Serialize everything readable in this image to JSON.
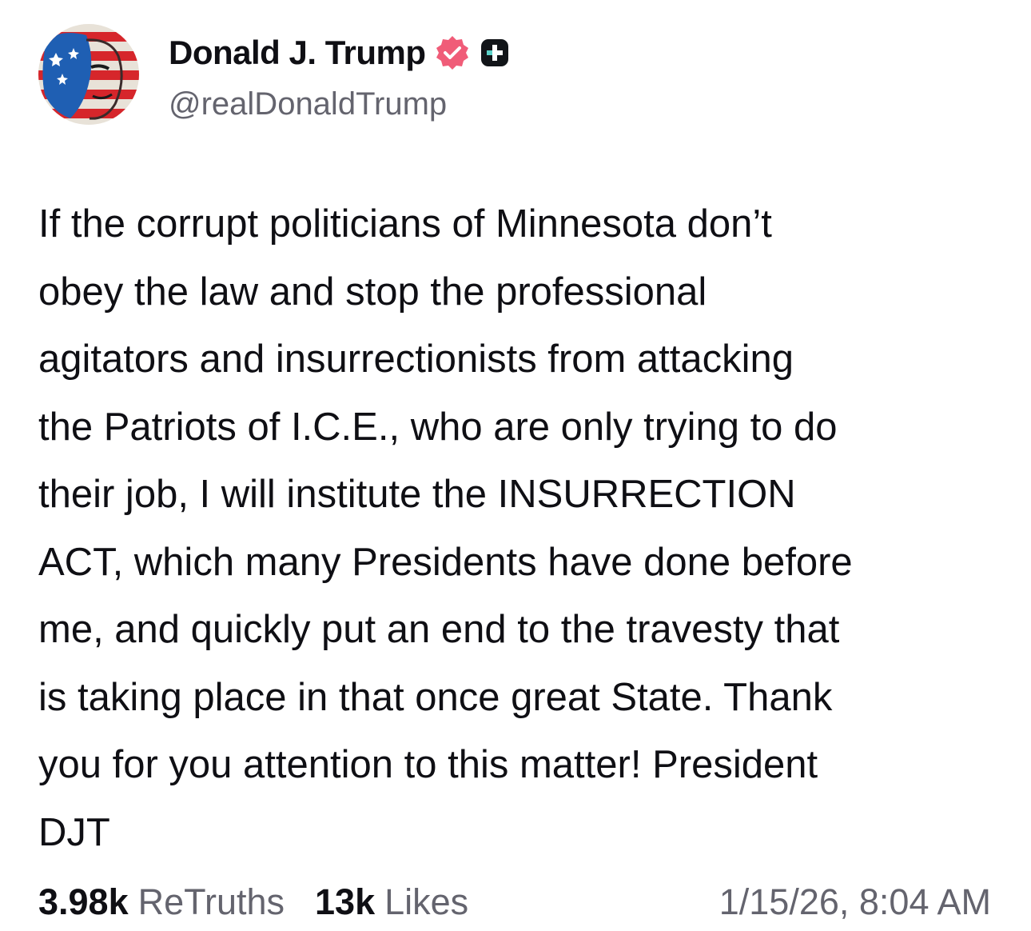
{
  "author": {
    "display_name": "Donald J. Trump",
    "handle": "@realDonaldTrump",
    "verified_icon": "verified-badge-icon",
    "plus_icon": "plus-badge-icon",
    "verified_color": "#f05c78"
  },
  "post": {
    "text": "If the corrupt politicians of Minnesota don’t\nobey the law and stop the professional\nagitators and insurrectionists from attacking\nthe Patriots of I.C.E., who are only trying to do\ntheir job, I will institute the INSURRECTION\nACT, which many Presidents have done before\nme, and quickly put an end to the travesty that\nis taking place in that once great State. Thank\nyou for you attention to this matter! President\nDJT"
  },
  "stats": {
    "retruths_count": "3.98k",
    "retruths_label": "ReTruths",
    "likes_count": "13k",
    "likes_label": "Likes",
    "timestamp": "1/15/26, 8:04 AM"
  }
}
